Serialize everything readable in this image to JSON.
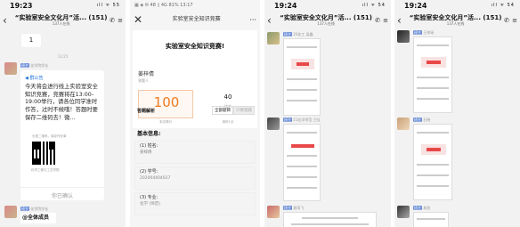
{
  "panel1": {
    "status": {
      "time": "19:23",
      "icons": "ıll ᯤ 55"
    },
    "header": {
      "title": "“实验室安全文化月”活... (151)",
      "subtitle": "137人在线"
    },
    "msg_number": "1",
    "timestamp": "13:25",
    "user": {
      "tag": "班主",
      "name": "化学院学长"
    },
    "announcement": {
      "label": "群公告",
      "text": "今天将会进行线上实验室安全知识竞赛，竞赛将在13:00-19:00举行，请各位同学准时作答，过时不候哦！答题时要保存二维码去！微...",
      "qr_label": "长按二维码，保存作业单",
      "group_name": "化学工程与工艺学院",
      "confirm": "你已确认"
    },
    "user2": {
      "tag": "班主",
      "name": "化学院学长"
    },
    "all_members": "@全体成员"
  },
  "panel2": {
    "status": {
      "time": "▦ ◈ ✉ 48 ▯ 4G 81% 13:17"
    },
    "header": {
      "title": "实验室安全知识竞赛"
    },
    "contest_title": "实验室安全知识竞赛!",
    "person": {
      "name": "姜梓倩",
      "role": "答题人"
    },
    "score": "100",
    "score_label": "本次得分",
    "rank": "40",
    "rank_label": "排名",
    "time_label": "用时1分",
    "answers": {
      "label": "答题解析",
      "tab_all": "全部题目",
      "tab_wrong": "只看错题"
    },
    "basic_info": "基本信息:",
    "fields": [
      {
        "label": "(1) 姓名:",
        "value": "姜梓倩"
      },
      {
        "label": "(2) 学号:",
        "value": "202004404027"
      },
      {
        "label": "(3) 专业:",
        "value": "化学 (师范)"
      }
    ]
  },
  "panel3": {
    "status": {
      "time": "19:24",
      "icons": "ıll ᯤ 54"
    },
    "header": {
      "title": "“实验室安全文化月”活... (151)",
      "subtitle": "137人在线"
    },
    "users": [
      {
        "tag": "班主",
        "name": "20化工 梁鑫"
      },
      {
        "tag": "班主",
        "name": "21化学师范·卫佳"
      },
      {
        "tag": "班主",
        "name": "夏雨飞"
      }
    ]
  },
  "panel4": {
    "status": {
      "time": "19:24",
      "icons": "ıll ᯤ 54"
    },
    "header": {
      "title": "“实验室安全文化月”活... (151)",
      "subtitle": "137人在线"
    },
    "users": [
      {
        "tag": "班主",
        "name": "王梓瑶"
      },
      {
        "tag": "班主",
        "name": "石晓"
      },
      {
        "tag": "班主",
        "name": "易旭"
      }
    ]
  }
}
